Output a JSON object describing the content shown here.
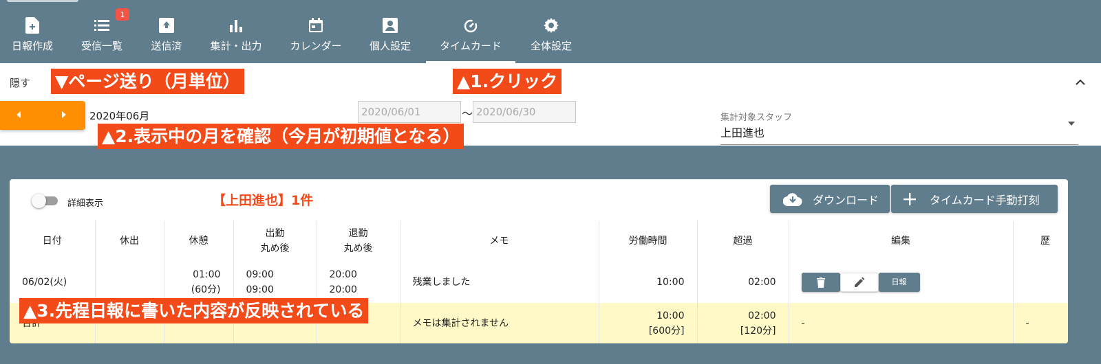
{
  "nav": {
    "items": [
      {
        "label": "日報作成"
      },
      {
        "label": "受信一覧",
        "badge": "1"
      },
      {
        "label": "送信済"
      },
      {
        "label": "集計・出力"
      },
      {
        "label": "カレンダー"
      },
      {
        "label": "個人設定"
      },
      {
        "label": "タイムカード",
        "active": true
      },
      {
        "label": "全体設定"
      }
    ]
  },
  "filter": {
    "hide_label": "隠す",
    "month": "2020年06月",
    "date_from": "2020/06/01",
    "separator": "〜",
    "date_to": "2020/06/30",
    "staff_caption": "集計対象スタッフ",
    "staff_value": "上田進也"
  },
  "annotations": {
    "page_nav": "▼ページ送り（月単位）",
    "click": "▲1.クリック",
    "month_check": "▲2.表示中の月を確認（今月が初期値となる）",
    "reflected": "▲3.先程日報に書いた内容が反映されている"
  },
  "card": {
    "toggle_label": "詳細表示",
    "title": "【上田進也】1件",
    "download_label": "ダウンロード",
    "manual_label": "タイムカード手動打刻"
  },
  "table": {
    "headers": {
      "date": "日付",
      "holiday": "休出",
      "break": "休憩",
      "in_1": "出勤",
      "in_2": "丸め後",
      "out_1": "退勤",
      "out_2": "丸め後",
      "memo": "メモ",
      "work": "労働時間",
      "over": "超過",
      "edit": "編集",
      "history": "歴"
    },
    "rows": [
      {
        "date": "06/02(火)",
        "holiday": "",
        "break_time": "01:00",
        "break_min": "(60分)",
        "in_time": "09:00",
        "in_rounded": "09:00",
        "out_time": "20:00",
        "out_rounded": "20:00",
        "memo": "残業しました",
        "work": "10:00",
        "over": "02:00",
        "report_label": "日報"
      }
    ],
    "total": {
      "label": "合計",
      "memo": "メモは集計されません",
      "work": "10:00",
      "work_min": "[600分]",
      "over": "02:00",
      "over_min": "[120分]",
      "edit": "-",
      "history": "-"
    }
  },
  "colors": {
    "nav_bg": "#5f7d8c",
    "accent_orange": "#ff8f00",
    "annotation_red": "#f34a1a",
    "badge_red": "#f25545",
    "total_row_bg": "#fff9c8"
  }
}
